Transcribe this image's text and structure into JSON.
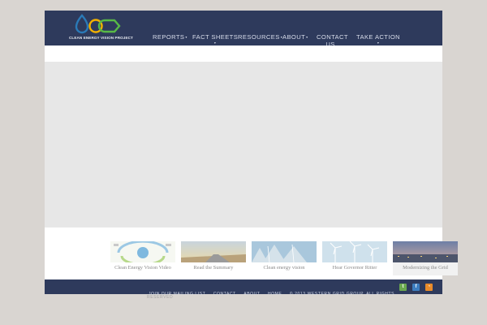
{
  "logo": {
    "text": "CLEAN ENERGY VISION PROJECT",
    "colors": [
      "#2a7ab8",
      "#f3b200",
      "#58b946",
      "#7fc8e8"
    ]
  },
  "nav": {
    "items": [
      {
        "label": "REPORTS",
        "caret": "▾"
      },
      {
        "label": "FACT SHEETS",
        "caret": "▾"
      },
      {
        "label": "RESOURCES",
        "caret": "▾"
      },
      {
        "label": "ABOUT",
        "caret": "▾"
      },
      {
        "label": "CONTACT US"
      },
      {
        "label": "TAKE ACTION",
        "caret": "▾"
      }
    ]
  },
  "thumbnails": [
    {
      "caption": "Clean Energy Vision Video"
    },
    {
      "caption": "Read the Summary"
    },
    {
      "caption": "Clean energy vision"
    },
    {
      "caption": "Hear Governor Ritter"
    },
    {
      "caption": "Modernizing the Grid"
    }
  ],
  "footer": {
    "links": [
      "JOIN OUR MAILING LIST",
      "CONTACT",
      "ABOUT",
      "HOME"
    ],
    "copyright": "© 2013 WESTERN GRID GROUP. ALL RIGHTS",
    "copyright_overflow": "RESERVED"
  },
  "social": [
    {
      "icon": "twitter-icon",
      "glyph": "t",
      "color": "#6aa84f"
    },
    {
      "icon": "facebook-icon",
      "glyph": "f",
      "color": "#3d7ec0"
    },
    {
      "icon": "rss-icon",
      "glyph": "◔",
      "color": "#e98b2a"
    }
  ]
}
